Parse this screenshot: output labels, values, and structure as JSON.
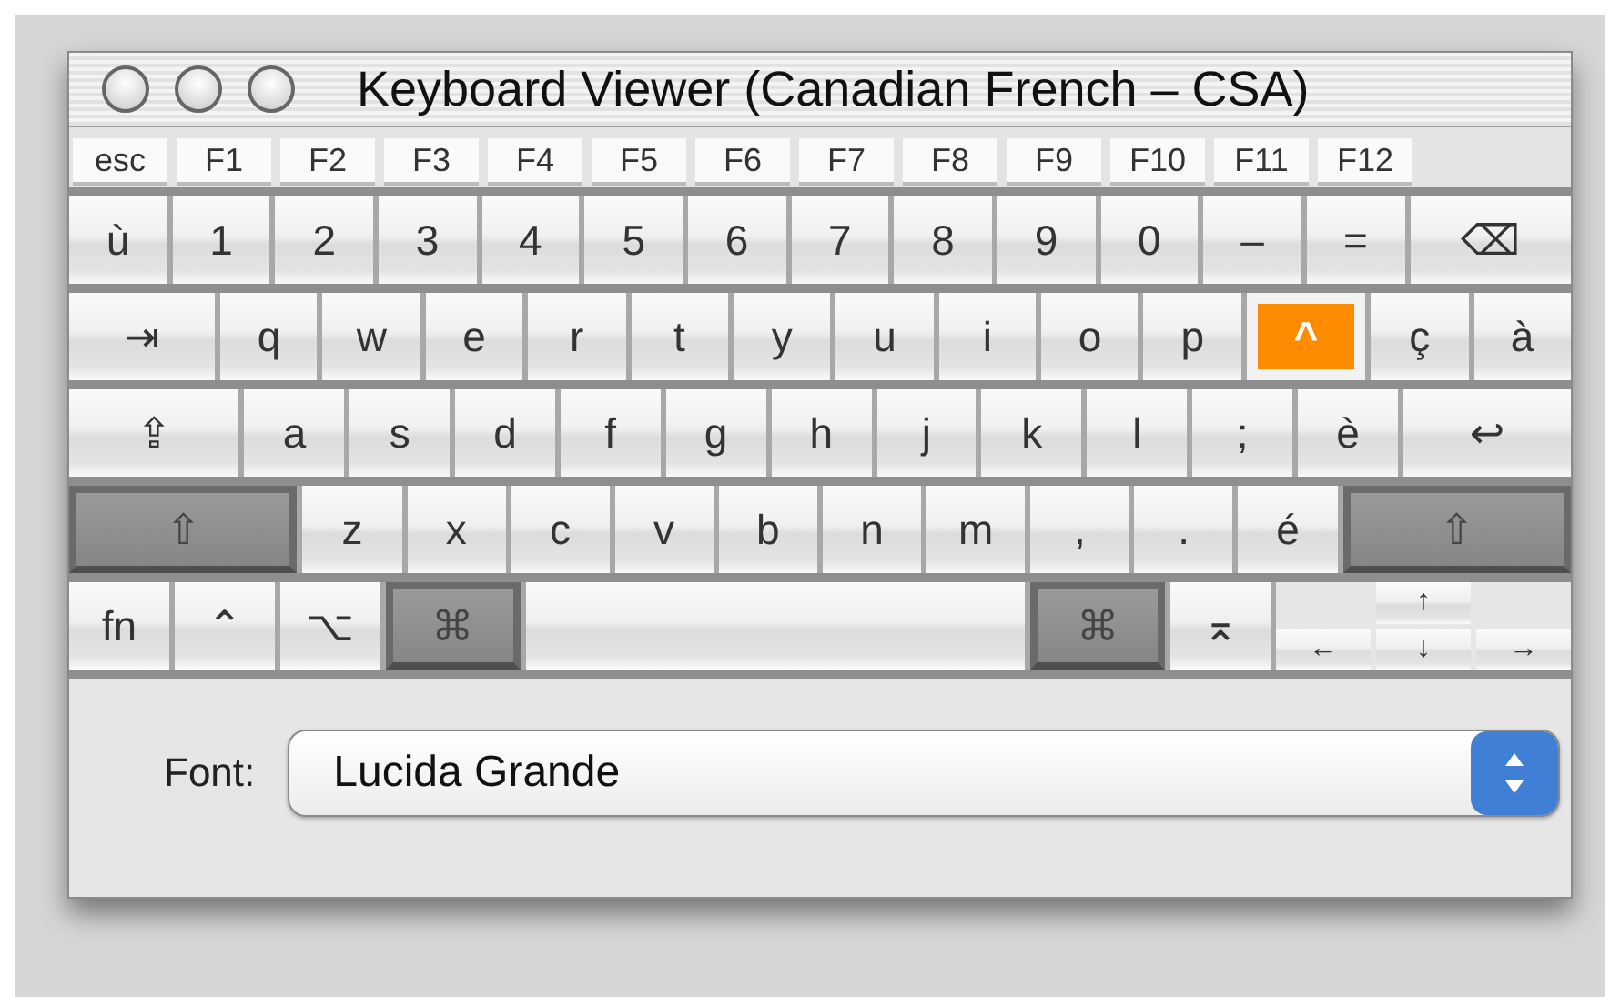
{
  "window": {
    "title": "Keyboard Viewer (Canadian French – CSA)"
  },
  "function_keys": [
    {
      "label": "esc"
    },
    {
      "label": "F1"
    },
    {
      "label": "F2"
    },
    {
      "label": "F3"
    },
    {
      "label": "F4"
    },
    {
      "label": "F5"
    },
    {
      "label": "F6"
    },
    {
      "label": "F7"
    },
    {
      "label": "F8"
    },
    {
      "label": "F9"
    },
    {
      "label": "F10"
    },
    {
      "label": "F11"
    },
    {
      "label": "F12"
    }
  ],
  "rows": [
    [
      {
        "kind": "char",
        "label": "ù",
        "pressed": false,
        "highlighted": false
      },
      {
        "kind": "char",
        "label": "1",
        "pressed": false,
        "highlighted": false
      },
      {
        "kind": "char",
        "label": "2",
        "pressed": false,
        "highlighted": false
      },
      {
        "kind": "char",
        "label": "3",
        "pressed": false,
        "highlighted": false
      },
      {
        "kind": "char",
        "label": "4",
        "pressed": false,
        "highlighted": false
      },
      {
        "kind": "char",
        "label": "5",
        "pressed": false,
        "highlighted": false
      },
      {
        "kind": "char",
        "label": "6",
        "pressed": false,
        "highlighted": false
      },
      {
        "kind": "char",
        "label": "7",
        "pressed": false,
        "highlighted": false
      },
      {
        "kind": "char",
        "label": "8",
        "pressed": false,
        "highlighted": false
      },
      {
        "kind": "char",
        "label": "9",
        "pressed": false,
        "highlighted": false
      },
      {
        "kind": "char",
        "label": "0",
        "pressed": false,
        "highlighted": false
      },
      {
        "kind": "char",
        "label": "–",
        "pressed": false,
        "highlighted": false
      },
      {
        "kind": "char",
        "label": "=",
        "pressed": false,
        "highlighted": false
      },
      {
        "kind": "backspace",
        "label": "⌫",
        "pressed": false,
        "highlighted": false
      }
    ],
    [
      {
        "kind": "tab",
        "label": "⇥",
        "pressed": false,
        "highlighted": false
      },
      {
        "kind": "char",
        "label": "q",
        "pressed": false,
        "highlighted": false
      },
      {
        "kind": "char",
        "label": "w",
        "pressed": false,
        "highlighted": false
      },
      {
        "kind": "char",
        "label": "e",
        "pressed": false,
        "highlighted": false
      },
      {
        "kind": "char",
        "label": "r",
        "pressed": false,
        "highlighted": false
      },
      {
        "kind": "char",
        "label": "t",
        "pressed": false,
        "highlighted": false
      },
      {
        "kind": "char",
        "label": "y",
        "pressed": false,
        "highlighted": false
      },
      {
        "kind": "char",
        "label": "u",
        "pressed": false,
        "highlighted": false
      },
      {
        "kind": "char",
        "label": "i",
        "pressed": false,
        "highlighted": false
      },
      {
        "kind": "char",
        "label": "o",
        "pressed": false,
        "highlighted": false
      },
      {
        "kind": "char",
        "label": "p",
        "pressed": false,
        "highlighted": false
      },
      {
        "kind": "char",
        "label": "^",
        "pressed": false,
        "highlighted": true
      },
      {
        "kind": "char",
        "label": "ç",
        "pressed": false,
        "highlighted": false
      },
      {
        "kind": "char",
        "label": "à",
        "pressed": false,
        "highlighted": false
      }
    ],
    [
      {
        "kind": "caps",
        "label": "⇪",
        "pressed": false,
        "highlighted": false
      },
      {
        "kind": "char",
        "label": "a",
        "pressed": false,
        "highlighted": false
      },
      {
        "kind": "char",
        "label": "s",
        "pressed": false,
        "highlighted": false
      },
      {
        "kind": "char",
        "label": "d",
        "pressed": false,
        "highlighted": false
      },
      {
        "kind": "char",
        "label": "f",
        "pressed": false,
        "highlighted": false
      },
      {
        "kind": "char",
        "label": "g",
        "pressed": false,
        "highlighted": false
      },
      {
        "kind": "char",
        "label": "h",
        "pressed": false,
        "highlighted": false
      },
      {
        "kind": "char",
        "label": "j",
        "pressed": false,
        "highlighted": false
      },
      {
        "kind": "char",
        "label": "k",
        "pressed": false,
        "highlighted": false
      },
      {
        "kind": "char",
        "label": "l",
        "pressed": false,
        "highlighted": false
      },
      {
        "kind": "char",
        "label": ";",
        "pressed": false,
        "highlighted": false
      },
      {
        "kind": "char",
        "label": "è",
        "pressed": false,
        "highlighted": false
      },
      {
        "kind": "return",
        "label": "↩",
        "pressed": false,
        "highlighted": false
      }
    ],
    [
      {
        "kind": "shift",
        "label": "⇧",
        "pressed": true,
        "highlighted": false
      },
      {
        "kind": "char",
        "label": "z",
        "pressed": false,
        "highlighted": false
      },
      {
        "kind": "char",
        "label": "x",
        "pressed": false,
        "highlighted": false
      },
      {
        "kind": "char",
        "label": "c",
        "pressed": false,
        "highlighted": false
      },
      {
        "kind": "char",
        "label": "v",
        "pressed": false,
        "highlighted": false
      },
      {
        "kind": "char",
        "label": "b",
        "pressed": false,
        "highlighted": false
      },
      {
        "kind": "char",
        "label": "n",
        "pressed": false,
        "highlighted": false
      },
      {
        "kind": "char",
        "label": "m",
        "pressed": false,
        "highlighted": false
      },
      {
        "kind": "char",
        "label": ",",
        "pressed": false,
        "highlighted": false
      },
      {
        "kind": "char",
        "label": ".",
        "pressed": false,
        "highlighted": false
      },
      {
        "kind": "char",
        "label": "é",
        "pressed": false,
        "highlighted": false
      },
      {
        "kind": "shift",
        "label": "⇧",
        "pressed": true,
        "highlighted": false
      }
    ],
    [
      {
        "kind": "char",
        "label": "fn",
        "pressed": false,
        "highlighted": false
      },
      {
        "kind": "char",
        "label": "⌃",
        "pressed": false,
        "highlighted": false
      },
      {
        "kind": "char",
        "label": "⌥",
        "pressed": false,
        "highlighted": false
      },
      {
        "kind": "command",
        "label": "⌘",
        "pressed": true,
        "highlighted": false
      },
      {
        "kind": "space",
        "pressed": false,
        "highlighted": false
      },
      {
        "kind": "command",
        "label": "⌘",
        "pressed": true,
        "highlighted": false
      },
      {
        "kind": "char",
        "label": "⌅",
        "pressed": false,
        "highlighted": false
      },
      {
        "kind": "up",
        "label": "↑",
        "pressed": false,
        "highlighted": false
      },
      {
        "kind": "left",
        "label": "←",
        "pressed": false,
        "highlighted": false
      },
      {
        "kind": "down",
        "label": "↓",
        "pressed": false,
        "highlighted": false
      },
      {
        "kind": "right",
        "label": "→",
        "pressed": false,
        "highlighted": false
      }
    ]
  ],
  "font": {
    "label": "Font:",
    "value": "Lucida Grande"
  }
}
